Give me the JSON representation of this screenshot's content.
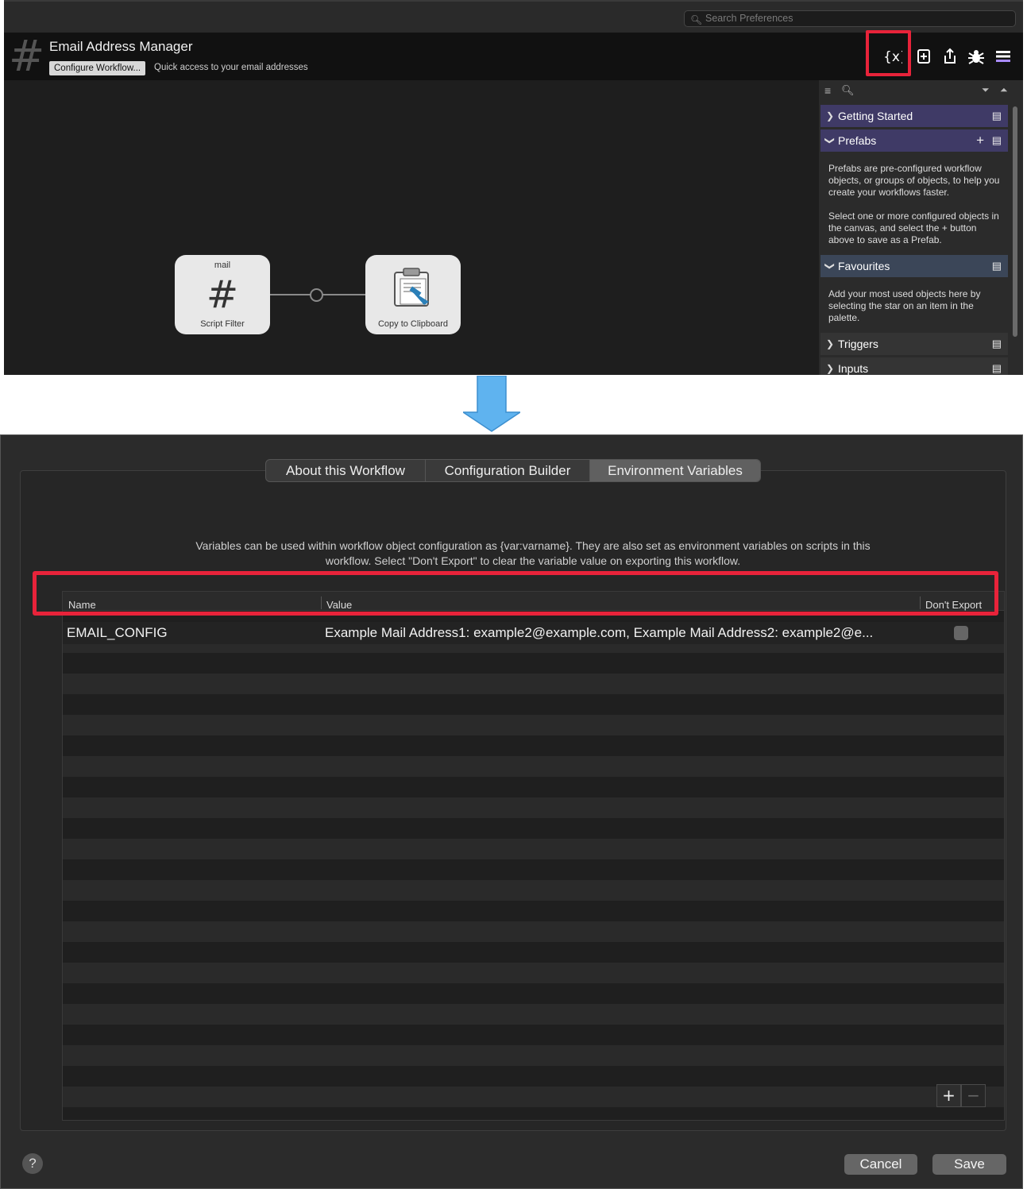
{
  "search": {
    "placeholder": "Search Preferences"
  },
  "workflow": {
    "title": "Email Address Manager",
    "configure_label": "Configure Workflow...",
    "description": "Quick access to your email addresses"
  },
  "toolbar": {
    "variables_icon": "variables-icon",
    "add_icon": "plus-square-icon",
    "share_icon": "share-icon",
    "debug_icon": "bug-icon",
    "menu_icon": "hamburger-icon"
  },
  "canvas": {
    "nodes": [
      {
        "top_label": "mail",
        "label": "Script Filter",
        "icon": "hash-icon"
      },
      {
        "top_label": "",
        "label": "Copy to Clipboard",
        "icon": "clipboard-icon"
      }
    ]
  },
  "palette": {
    "sections": [
      {
        "label": "Getting Started",
        "expanded": false
      },
      {
        "label": "Prefabs",
        "expanded": true
      },
      {
        "label": "Favourites",
        "expanded": true
      },
      {
        "label": "Triggers",
        "expanded": false
      },
      {
        "label": "Inputs",
        "expanded": false
      }
    ],
    "prefabs_text_1": "Prefabs are pre-configured workflow objects, or groups of objects, to help you create your workflows faster.",
    "prefabs_text_2": "Select one or more configured objects in the canvas, and select the + button above to save as a Prefab.",
    "favourites_text": "Add your most used objects here by selecting the star on an item in the palette."
  },
  "sheet": {
    "tabs": [
      {
        "label": "About this Workflow",
        "active": false
      },
      {
        "label": "Configuration Builder",
        "active": false
      },
      {
        "label": "Environment Variables",
        "active": true
      }
    ],
    "info_text": "Variables can be used within workflow object configuration as {var:varname}. They are also set as environment variables on scripts in this workflow. Select \"Don't Export\" to clear the variable value on exporting this workflow.",
    "columns": {
      "name": "Name",
      "value": "Value",
      "dont_export": "Don't Export"
    },
    "rows": [
      {
        "name": "EMAIL_CONFIG",
        "value": "Example Mail Address1: example2@example.com, Example Mail Address2: example2@e...",
        "dont_export": false
      }
    ],
    "add_label": "+",
    "remove_label": "−",
    "help_label": "?",
    "cancel_label": "Cancel",
    "save_label": "Save"
  },
  "colors": {
    "highlight": "#e8233a",
    "palette_header": "#3f3a66",
    "arrow": "#5fb3ef"
  }
}
